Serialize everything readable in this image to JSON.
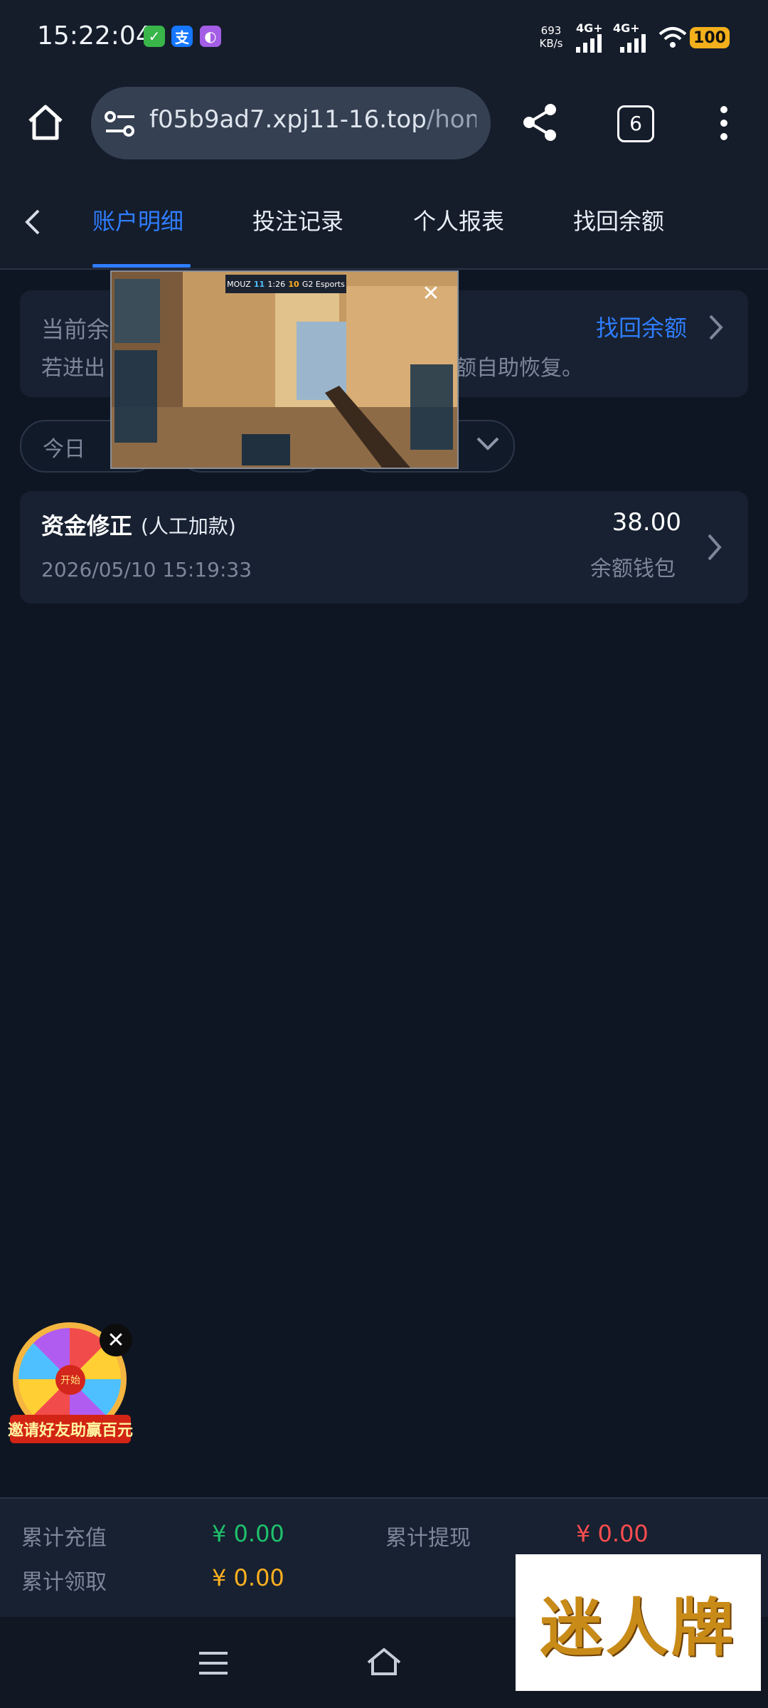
{
  "status": {
    "time": "15:22:04",
    "speed_value": "693",
    "speed_unit": "KB/s",
    "net1": "4G+",
    "net2": "4G+",
    "battery": "100"
  },
  "browser": {
    "url_main": "f05b9ad7.xpj11-16.top",
    "url_path": "/home/re",
    "tab_count": "6"
  },
  "nav": {
    "tabs": [
      "账户明细",
      "投注记录",
      "个人报表",
      "找回余额"
    ],
    "active_index": 0
  },
  "balance_card": {
    "title_partial": "当前余",
    "desc_partial_left": "若进出",
    "desc_partial_right": "额自助恢复。",
    "link": "找回余额"
  },
  "filter": {
    "date": "今日"
  },
  "record": {
    "title": "资金修正",
    "subtitle": "(人工加款)",
    "datetime": "2026/05/10 15:19:33",
    "amount": "38.00",
    "wallet": "余额钱包"
  },
  "footer": {
    "recharge_label": "累计充值",
    "recharge_value": "¥ 0.00",
    "withdraw_label": "累计提现",
    "withdraw_value": "¥ 0.00",
    "claim_label": "累计领取",
    "claim_value": "¥ 0.00"
  },
  "promo": {
    "wheel_center": "开始",
    "wheel_banner": "邀请好友助赢百元"
  },
  "ad": {
    "text": "迷人牌"
  },
  "video": {
    "team_left": "MOUZ",
    "score_left": "11",
    "clock": "1:26",
    "score_right": "10",
    "team_right": "G2 Esports"
  },
  "colors": {
    "accent": "#2f7dff",
    "green": "#1fc16b",
    "red": "#ff4d4f",
    "orange": "#ffb020"
  }
}
